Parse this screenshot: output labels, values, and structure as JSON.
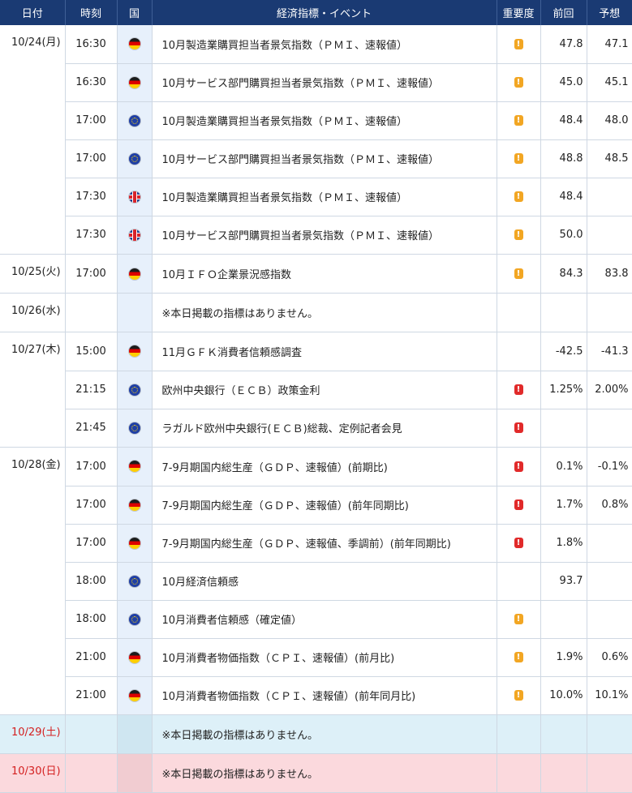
{
  "columns": {
    "date": "日付",
    "time": "時刻",
    "country": "国",
    "event": "経済指標・イベント",
    "importance": "重要度",
    "previous": "前回",
    "forecast": "予想"
  },
  "rows": [
    {
      "date": "10/24(月)",
      "time": "16:30",
      "flag": "germany",
      "event": "10月製造業購買担当者景気指数（ＰＭＩ、速報値）",
      "importance": "medium",
      "previous": "47.8",
      "forecast": "47.1"
    },
    {
      "date": "",
      "time": "16:30",
      "flag": "germany",
      "event": "10月サービス部門購買担当者景気指数（ＰＭＩ、速報値）",
      "importance": "medium",
      "previous": "45.0",
      "forecast": "45.1"
    },
    {
      "date": "",
      "time": "17:00",
      "flag": "eu",
      "event": "10月製造業購買担当者景気指数（ＰＭＩ、速報値）",
      "importance": "medium",
      "previous": "48.4",
      "forecast": "48.0"
    },
    {
      "date": "",
      "time": "17:00",
      "flag": "eu",
      "event": "10月サービス部門購買担当者景気指数（ＰＭＩ、速報値）",
      "importance": "medium",
      "previous": "48.8",
      "forecast": "48.5"
    },
    {
      "date": "",
      "time": "17:30",
      "flag": "uk",
      "event": "10月製造業購買担当者景気指数（ＰＭＩ、速報値）",
      "importance": "medium",
      "previous": "48.4",
      "forecast": ""
    },
    {
      "date": "",
      "time": "17:30",
      "flag": "uk",
      "event": "10月サービス部門購買担当者景気指数（ＰＭＩ、速報値）",
      "importance": "medium",
      "previous": "50.0",
      "forecast": ""
    },
    {
      "date": "10/25(火)",
      "time": "17:00",
      "flag": "germany",
      "event": "10月ＩＦＯ企業景況感指数",
      "importance": "medium",
      "previous": "84.3",
      "forecast": "83.8"
    },
    {
      "date": "10/26(水)",
      "time": "",
      "flag": "",
      "event": "※本日掲載の指標はありません。",
      "importance": "",
      "previous": "",
      "forecast": ""
    },
    {
      "date": "10/27(木)",
      "time": "15:00",
      "flag": "germany",
      "event": "11月ＧＦＫ消費者信頼感調査",
      "importance": "",
      "previous": "-42.5",
      "forecast": "-41.3"
    },
    {
      "date": "",
      "time": "21:15",
      "flag": "eu",
      "event": "欧州中央銀行（ＥＣＢ）政策金利",
      "importance": "high",
      "previous": "1.25%",
      "forecast": "2.00%"
    },
    {
      "date": "",
      "time": "21:45",
      "flag": "eu",
      "event": "ラガルド欧州中央銀行(ＥＣＢ)総裁、定例記者会見",
      "importance": "high",
      "previous": "",
      "forecast": ""
    },
    {
      "date": "10/28(金)",
      "time": "17:00",
      "flag": "germany",
      "event": "7-9月期国内総生産（ＧＤＰ、速報値）(前期比)",
      "importance": "high",
      "previous": "0.1%",
      "forecast": "-0.1%"
    },
    {
      "date": "",
      "time": "17:00",
      "flag": "germany",
      "event": "7-9月期国内総生産（ＧＤＰ、速報値）(前年同期比)",
      "importance": "high",
      "previous": "1.7%",
      "forecast": "0.8%"
    },
    {
      "date": "",
      "time": "17:00",
      "flag": "germany",
      "event": "7-9月期国内総生産（ＧＤＰ、速報値、季調前）(前年同期比)",
      "importance": "high",
      "previous": "1.8%",
      "forecast": ""
    },
    {
      "date": "",
      "time": "18:00",
      "flag": "eu",
      "event": "10月経済信頼感",
      "importance": "",
      "previous": "93.7",
      "forecast": ""
    },
    {
      "date": "",
      "time": "18:00",
      "flag": "eu",
      "event": "10月消費者信頼感（確定値）",
      "importance": "medium",
      "previous": "",
      "forecast": ""
    },
    {
      "date": "",
      "time": "21:00",
      "flag": "germany",
      "event": "10月消費者物価指数（ＣＰＩ、速報値）(前月比)",
      "importance": "medium",
      "previous": "1.9%",
      "forecast": "0.6%"
    },
    {
      "date": "",
      "time": "21:00",
      "flag": "germany",
      "event": "10月消費者物価指数（ＣＰＩ、速報値）(前年同月比)",
      "importance": "medium",
      "previous": "10.0%",
      "forecast": "10.1%"
    },
    {
      "date": "10/29(土)",
      "time": "",
      "flag": "",
      "event": "※本日掲載の指標はありません。",
      "importance": "",
      "previous": "",
      "forecast": "",
      "day": "sat"
    },
    {
      "date": "10/30(日)",
      "time": "",
      "flag": "",
      "event": "※本日掲載の指標はありません。",
      "importance": "",
      "previous": "",
      "forecast": "",
      "day": "sun"
    }
  ],
  "importance_icons": {
    "medium": "!",
    "high": "!"
  },
  "colors": {
    "header_bg": "#1a3a73",
    "flag_col_bg": "#e7f0fb",
    "saturday_bg": "#ddf0f8",
    "sunday_bg": "#fbd9dd",
    "weekend_date": "#d42020",
    "importance_medium": "#f2a623",
    "importance_high": "#e12a2a"
  }
}
